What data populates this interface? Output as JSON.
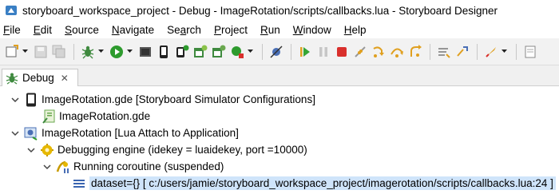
{
  "window": {
    "title": "storyboard_workspace_project - Debug - ImageRotation/scripts/callbacks.lua - Storyboard Designer"
  },
  "menu": [
    {
      "label": "File",
      "mnemonic": "F",
      "rest": "ile"
    },
    {
      "label": "Edit",
      "mnemonic": "E",
      "rest": "dit"
    },
    {
      "label": "Source",
      "mnemonic": "S",
      "rest": "ource"
    },
    {
      "label": "Navigate",
      "mnemonic": "N",
      "rest": "avigate"
    },
    {
      "label": "Search",
      "mnemonic": "a",
      "pre": "Se",
      "rest": "rch"
    },
    {
      "label": "Project",
      "mnemonic": "P",
      "rest": "roject"
    },
    {
      "label": "Run",
      "mnemonic": "R",
      "rest": "un"
    },
    {
      "label": "Window",
      "mnemonic": "W",
      "rest": "indow"
    },
    {
      "label": "Help",
      "mnemonic": "H",
      "rest": "elp"
    }
  ],
  "debug_view": {
    "tab_label": "Debug",
    "tree": {
      "launch_1": {
        "label": "ImageRotation.gde [Storyboard Simulator Configurations]",
        "child": "ImageRotation.gde"
      },
      "launch_2": {
        "label": "ImageRotation [Lua Attach to Application]",
        "engine": "Debugging engine (idekey = luaidekey, port =10000)",
        "thread": "Running coroutine (suspended)",
        "frame": "dataset={}  [ c:/users/jamie/storyboard_workspace_project/imagerotation/scripts/callbacks.lua:24 ]"
      }
    }
  },
  "colors": {
    "selection": "#cfe4fa",
    "run_green": "#2e9b2e",
    "stop_red": "#d9302c",
    "resume_green": "#35a535",
    "step_orange": "#e0a020",
    "engine_gold": "#e6b800"
  },
  "icons": {
    "window": "storyboard-app-icon",
    "tab": "debug-bug-icon",
    "launch_1": "device-icon",
    "launch_1_child": "lua-file-icon",
    "launch_2": "attach-app-icon",
    "engine": "debug-engine-icon",
    "thread": "thread-suspended-icon",
    "frame": "stack-frame-icon"
  }
}
